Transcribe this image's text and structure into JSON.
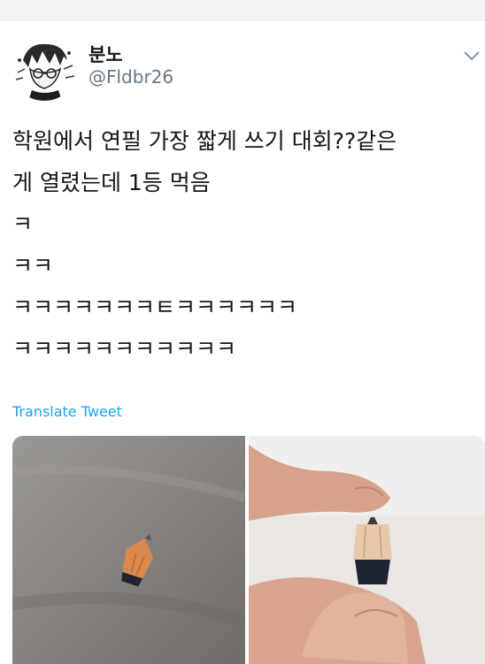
{
  "tweet": {
    "author_name": "분노",
    "author_handle": "@Fldbr26",
    "lines": [
      "학원에서 연필 가장 짧게 쓰기 대회??같은",
      "게 열렸는데 1등 먹음",
      "ㅋ",
      "ㅋㅋ",
      "ㅋㅋㅋㅋㅋㅋㅋㅌㅋㅋㅋㅋㅋㅋ",
      "ㅋㅋㅋㅋㅋㅋㅋㅋㅋㅋㅋ"
    ],
    "translate_label": "Translate Tweet"
  },
  "icons": {
    "menu": "chevron-down-icon"
  },
  "colors": {
    "link": "#1da1f2",
    "handle": "#657786",
    "text": "#14171a"
  }
}
